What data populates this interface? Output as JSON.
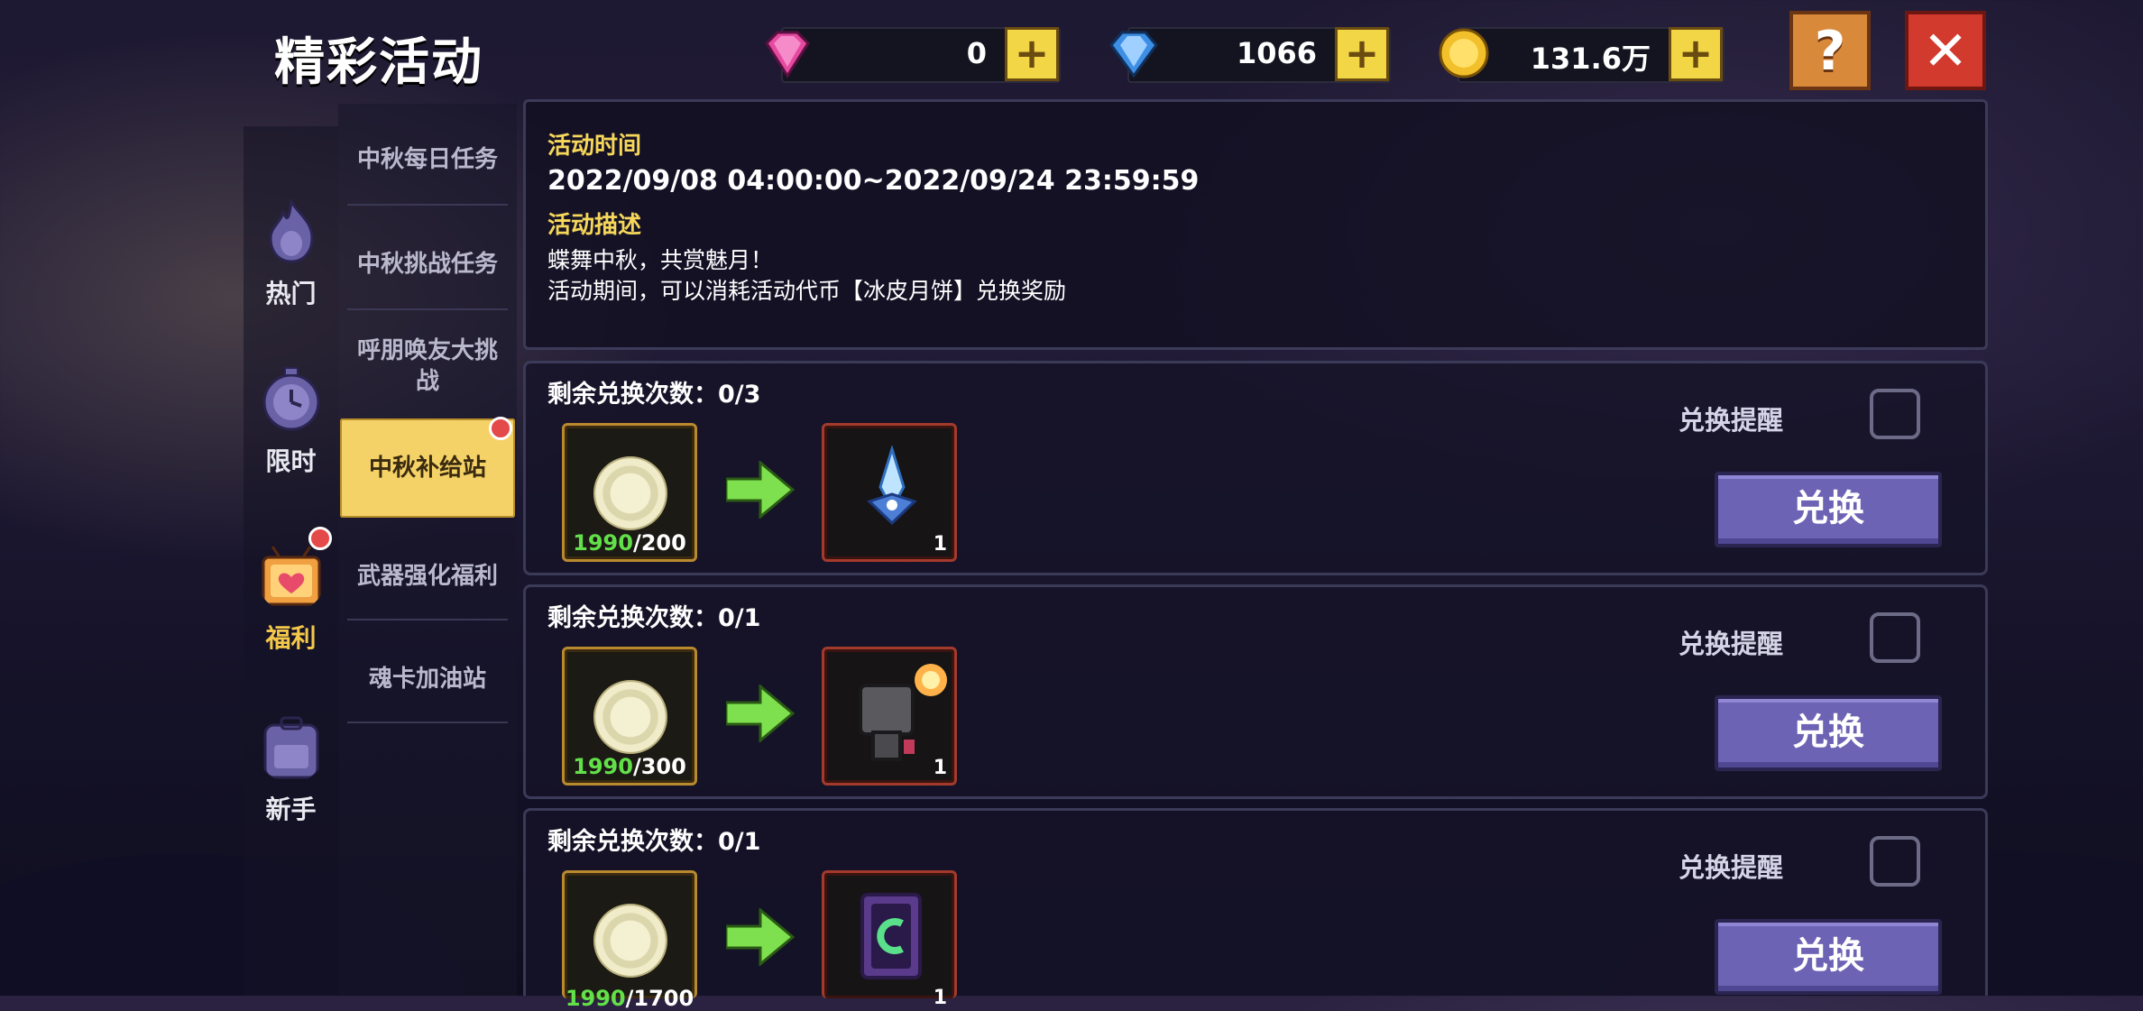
{
  "header": {
    "title": "精彩活动",
    "currencies": [
      {
        "name": "pink-gem",
        "value": "0"
      },
      {
        "name": "blue-gem",
        "value": "1066"
      },
      {
        "name": "gold-coin",
        "value": "131.6万"
      }
    ],
    "help_label": "?",
    "close_label": "✕"
  },
  "categories": [
    {
      "label": "热门",
      "icon": "flame-icon"
    },
    {
      "label": "限时",
      "icon": "clock-icon"
    },
    {
      "label": "福利",
      "icon": "gift-icon"
    },
    {
      "label": "新手",
      "icon": "backpack-icon"
    }
  ],
  "submenu": [
    {
      "label": "中秋每日任务"
    },
    {
      "label": "中秋挑战任务"
    },
    {
      "label": "呼朋唤友大挑战"
    },
    {
      "label": "中秋补给站"
    },
    {
      "label": "武器强化福利"
    },
    {
      "label": "魂卡加油站"
    }
  ],
  "info": {
    "time_heading": "活动时间",
    "time_value": "2022/09/08 04:00:00~2022/09/24 23:59:59",
    "desc_heading": "活动描述",
    "desc_line1": "蝶舞中秋，共赏魅月！",
    "desc_line2": "活动期间，可以消耗活动代币【冰皮月饼】兑换奖励"
  },
  "rows": [
    {
      "remain": "剩余兑换次数：0/3",
      "have": "1990",
      "need": "/200",
      "qty": "1",
      "remind": "兑换提醒",
      "button": "兑换",
      "reward_icon": "crystal-weapon-icon"
    },
    {
      "remain": "剩余兑换次数：0/1",
      "have": "1990",
      "need": "/300",
      "qty": "1",
      "remind": "兑换提醒",
      "button": "兑换",
      "reward_icon": "character-skin-icon"
    },
    {
      "remain": "剩余兑换次数：0/1",
      "have": "1990",
      "need": "/1700",
      "qty": "1",
      "remind": "兑换提醒",
      "button": "兑换",
      "reward_icon": "soul-card-icon"
    }
  ]
}
